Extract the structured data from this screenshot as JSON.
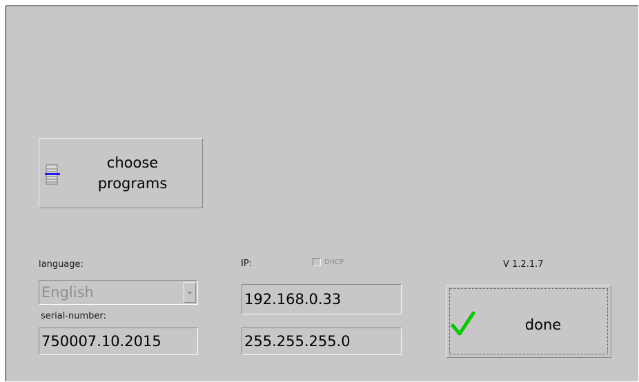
{
  "choose_programs": {
    "label": "choose\nprograms",
    "icon": "list-icon"
  },
  "language": {
    "label": "language:",
    "selected": "English"
  },
  "serial": {
    "label": "serial-number:",
    "value": "750007.10.2015"
  },
  "network": {
    "ip_label": "IP:",
    "dhcp_label": "DHCP",
    "dhcp_checked": false,
    "ip_value": "192.168.0.33",
    "mask_value": "255.255.255.0"
  },
  "version": "V 1.2.1.7",
  "done": {
    "label": "done",
    "icon": "check-icon"
  },
  "colors": {
    "panel": "#c8c6c8",
    "check": "#00cc00",
    "list_accent": "#2020ff"
  }
}
